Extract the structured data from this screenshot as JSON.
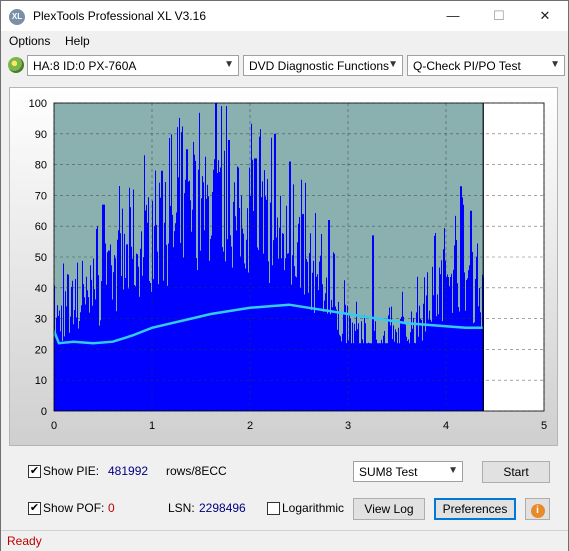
{
  "window": {
    "title": "PlexTools Professional XL V3.16",
    "icon_text": "XL",
    "controls": {
      "minimize": "—",
      "maximize": "☐",
      "close": "✕"
    }
  },
  "menu": {
    "options": "Options",
    "help": "Help"
  },
  "toolbar": {
    "drive": "HA:8 ID:0  PX-760A",
    "function": "DVD Diagnostic Functions",
    "test": "Q-Check PI/PO Test"
  },
  "controls": {
    "show_pie_label": "Show PIE:",
    "show_pie_checked": true,
    "pie_value": "481992",
    "rows_label": "rows/8ECC",
    "show_pof_label": "Show POF:",
    "show_pof_checked": true,
    "pof_value": "0",
    "lsn_label": "LSN:",
    "lsn_value": "2298496",
    "logarithmic_label": "Logarithmic",
    "logarithmic_checked": false,
    "sum_select": "SUM8 Test",
    "start_button": "Start",
    "view_log_button": "View Log",
    "preferences_button": "Preferences",
    "info_icon": "info-icon"
  },
  "status": {
    "text": "Ready"
  },
  "chart_data": {
    "type": "bar",
    "x_ticks": [
      "0",
      "1",
      "2",
      "3",
      "4",
      "5"
    ],
    "y_ticks": [
      "0",
      "10",
      "20",
      "30",
      "40",
      "50",
      "60",
      "70",
      "80",
      "90",
      "100"
    ],
    "xlim": [
      0,
      5
    ],
    "ylim": [
      0,
      100
    ],
    "end_marker_x": 4.38,
    "grid": true,
    "colors": {
      "pie": "#0000ff",
      "average": "#33ccee",
      "plot_bg": "#8ab0b0",
      "after_end_bg": "#ffffff"
    },
    "series": [
      {
        "values_x": [
          0.0,
          0.1,
          0.2,
          0.3,
          0.4,
          0.5,
          0.6,
          0.7,
          0.8,
          0.9,
          1.0,
          1.1,
          1.2,
          1.3,
          1.4,
          1.5,
          1.6,
          1.7,
          1.8,
          1.9,
          2.0,
          2.1,
          2.2,
          2.3,
          2.4,
          2.5,
          2.6,
          2.7,
          2.8,
          2.9,
          3.0,
          3.1,
          3.2,
          3.3,
          3.4,
          3.5,
          3.6,
          3.7,
          3.8,
          3.9,
          4.0,
          4.1,
          4.2,
          4.3,
          4.38
        ],
        "values_y": [
          38,
          40,
          42,
          44,
          47,
          52,
          56,
          60,
          64,
          67,
          70,
          72,
          75,
          77,
          80,
          83,
          86,
          84,
          82,
          80,
          78,
          76,
          74,
          72,
          70,
          67,
          60,
          52,
          45,
          38,
          34,
          30,
          28,
          27,
          28,
          30,
          33,
          38,
          44,
          50,
          55,
          58,
          56,
          50,
          45
        ],
        "peaks_x": [
          0.5,
          1.1,
          1.35,
          1.65,
          1.78,
          2.05,
          2.25,
          2.4,
          2.8,
          3.25,
          4.15,
          4.25
        ],
        "peaks_y": [
          67,
          78,
          85,
          100,
          88,
          82,
          90,
          81,
          62,
          57,
          73,
          65
        ]
      },
      {
        "values_x": [
          0.0,
          0.05,
          0.2,
          0.4,
          0.6,
          0.8,
          1.0,
          1.2,
          1.4,
          1.6,
          1.8,
          2.0,
          2.2,
          2.4,
          2.6,
          2.8,
          3.0,
          3.2,
          3.4,
          3.6,
          3.8,
          4.0,
          4.2,
          4.38
        ],
        "values_y": [
          26,
          22,
          22.5,
          22,
          22.5,
          24.5,
          27,
          28.5,
          30,
          31.5,
          32.5,
          33.5,
          34,
          34.5,
          33.5,
          32.5,
          31.5,
          30.5,
          29.5,
          28.5,
          28,
          27.5,
          27,
          27
        ]
      }
    ]
  }
}
